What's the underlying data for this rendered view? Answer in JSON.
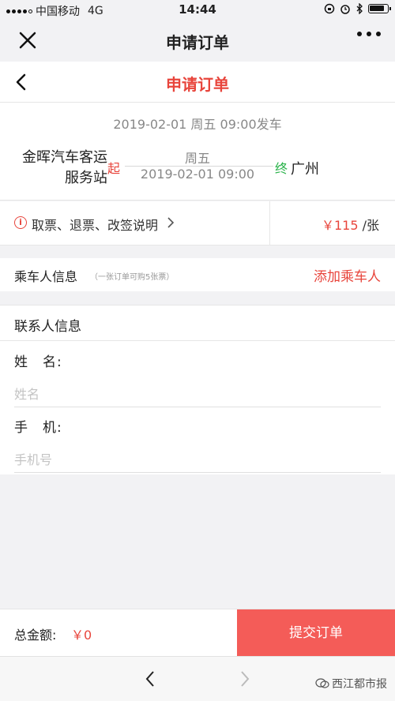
{
  "status_bar": {
    "carrier": "中国移动",
    "network": "4G",
    "time": "14:44"
  },
  "wechat_nav": {
    "title": "申请订单"
  },
  "page_header": {
    "title": "申请订单"
  },
  "trip": {
    "departure_line": "2019-02-01 周五 09:00发车",
    "from_station": "金晖汽车客运服务站",
    "start_mark": "起",
    "weekday": "周五",
    "datetime": "2019-02-01 09:00",
    "end_mark": "终",
    "to_station": "广州"
  },
  "ticket_info": {
    "notes_label": "取票、退票、改签说明",
    "price_amount": "￥115",
    "price_unit": "/张"
  },
  "passenger": {
    "title": "乘车人信息",
    "note": "（一张订单可购5张票）",
    "add_label": "添加乘车人"
  },
  "contact": {
    "title": "联系人信息",
    "name_label": "姓　名:",
    "name_value": "",
    "name_placeholder": "姓名",
    "phone_label": "手　机:",
    "phone_value": "",
    "phone_placeholder": "手机号"
  },
  "bottom_bar": {
    "total_label": "总金额:",
    "total_value": "￥0",
    "submit_label": "提交订单"
  },
  "watermark": {
    "text": "西江都市报"
  },
  "colors": {
    "accent": "#e8453c",
    "submit": "#f45c58",
    "end_mark": "#2bb34b"
  }
}
